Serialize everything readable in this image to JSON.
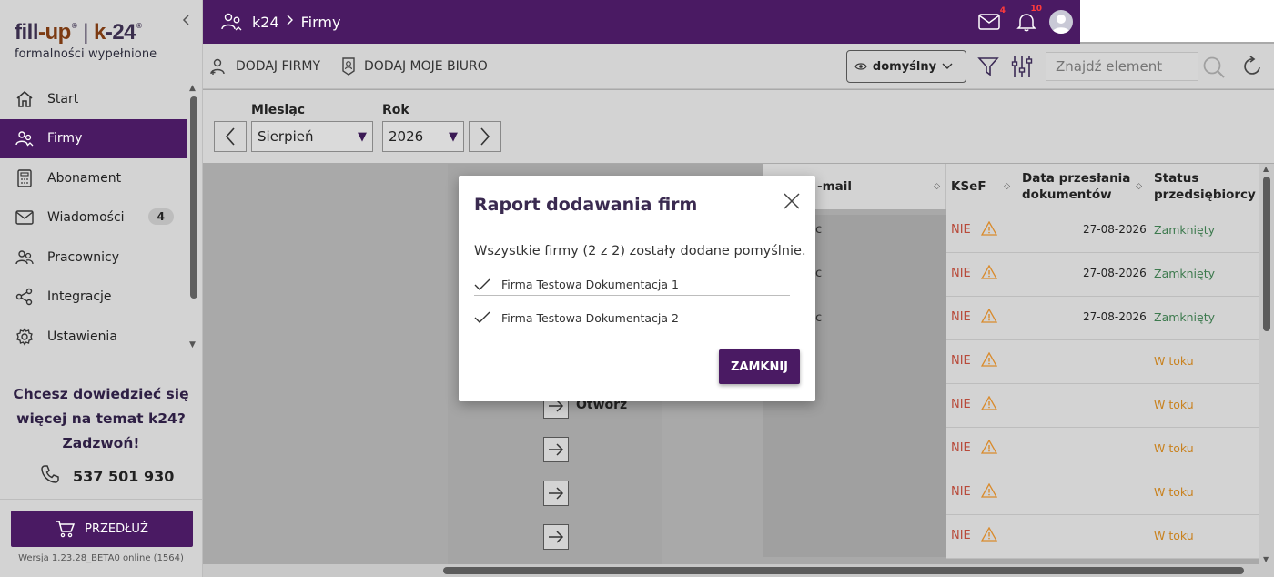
{
  "brand": {
    "part1": "fill",
    "part1b": "up",
    "part2": "k",
    "part2b": "24",
    "tagline": "formalności wypełnione"
  },
  "sidebar": {
    "items": [
      {
        "label": "Start",
        "icon": "home-icon"
      },
      {
        "label": "Firmy",
        "icon": "companies-icon",
        "active": true
      },
      {
        "label": "Abonament",
        "icon": "calculator-icon"
      },
      {
        "label": "Wiadomości",
        "icon": "mail-icon",
        "badge": "4"
      },
      {
        "label": "Pracownicy",
        "icon": "people-icon"
      },
      {
        "label": "Integracje",
        "icon": "share-icon"
      },
      {
        "label": "Ustawienia",
        "icon": "gear-icon"
      }
    ],
    "promo_line1": "Chcesz dowiedzieć się",
    "promo_line2": "więcej na temat k24?",
    "promo_line3": "Zadzwoń!",
    "phone": "537 501 930",
    "extend_label": "PRZEDŁUŻ",
    "version": "Wersja 1.23.28_BETA0 online (1564)"
  },
  "topbar": {
    "crumb_root": "k24",
    "crumb_current": "Firmy",
    "mail_count": "4",
    "notif_count": "10"
  },
  "toolbar": {
    "add_companies": "DODAJ FIRMY",
    "add_office": "DODAJ MOJE BIURO",
    "view": "domyślny",
    "search_placeholder": "Znajdź element"
  },
  "period": {
    "month_label": "Miesiąc",
    "month_value": "Sierpień",
    "year_label": "Rok",
    "year_value": "2026"
  },
  "table": {
    "headers": {
      "email": "-mail",
      "ksef": "KSeF",
      "date_line1": "Data przesłania",
      "date_line2": "dokumentów",
      "status_line1": "Status",
      "status_line2": "przedsiębiorcy"
    },
    "open_label": "Otwórz",
    "email_partial": "c",
    "rows": [
      {
        "ksef": "NIE",
        "date": "27-08-2026",
        "status": "Zamknięty",
        "kind": "closed"
      },
      {
        "ksef": "NIE",
        "date": "27-08-2026",
        "status": "Zamknięty",
        "kind": "closed"
      },
      {
        "ksef": "NIE",
        "date": "27-08-2026",
        "status": "Zamknięty",
        "kind": "closed"
      },
      {
        "ksef": "NIE",
        "date": "",
        "status": "W toku",
        "kind": "progress"
      },
      {
        "ksef": "NIE",
        "date": "",
        "status": "W toku",
        "kind": "progress"
      },
      {
        "ksef": "NIE",
        "date": "",
        "status": "W toku",
        "kind": "progress"
      },
      {
        "ksef": "NIE",
        "date": "",
        "status": "W toku",
        "kind": "progress"
      },
      {
        "ksef": "NIE",
        "date": "",
        "status": "W toku",
        "kind": "progress"
      }
    ]
  },
  "modal": {
    "title": "Raport dodawania firm",
    "message": "Wszystkie firmy (2 z 2) zostały dodane pomyślnie.",
    "items": [
      "Firma Testowa Dokumentacja 1",
      "Firma Testowa Dokumentacja 2"
    ],
    "close_button": "ZAMKNIJ"
  },
  "colors": {
    "brand_purple": "#4a1a63",
    "closed_green": "#3d7a4e",
    "progress_orange": "#c9821f",
    "ksef_red": "#b84a3a"
  }
}
